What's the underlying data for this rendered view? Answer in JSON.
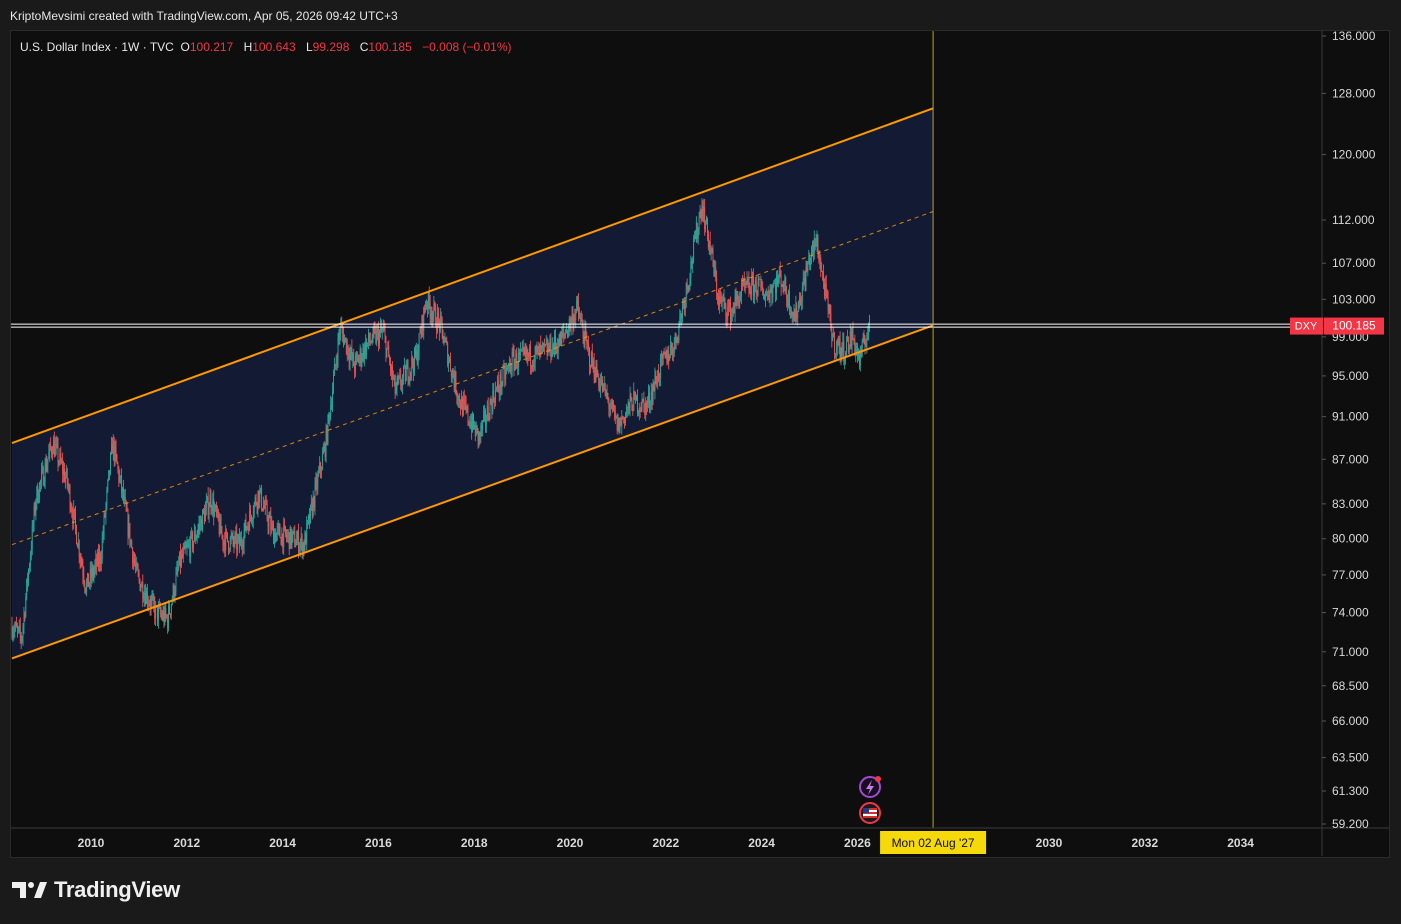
{
  "header": {
    "text": "KriptoMevsimi created with TradingView.com, Apr 05, 2026 09:42 UTC+3"
  },
  "legend": {
    "symbol": "U.S. Dollar Index · 1W · TVC",
    "open_label": "O",
    "open": "100.217",
    "high_label": "H",
    "high": "100.643",
    "low_label": "L",
    "low": "99.298",
    "close_label": "C",
    "close": "100.185",
    "change": "−0.008 (−0.01%)"
  },
  "brand": {
    "name": "TradingView",
    "icon": "tradingview-logo-icon"
  },
  "chart_data": {
    "type": "candlestick",
    "scale": "log",
    "ylim": [
      59.2,
      136.0
    ],
    "xlim": [
      2008.35,
      2035.6
    ],
    "y_ticks": [
      "136.000",
      "128.000",
      "120.000",
      "112.000",
      "107.000",
      "103.000",
      "99.000",
      "95.000",
      "91.000",
      "87.000",
      "83.000",
      "80.000",
      "77.000",
      "74.000",
      "71.000",
      "68.500",
      "66.000",
      "63.500",
      "61.300",
      "59.200"
    ],
    "x_ticks": [
      "2010",
      "2012",
      "2014",
      "2016",
      "2018",
      "2020",
      "2022",
      "2024",
      "2026",
      "2030",
      "2032",
      "2034"
    ],
    "last_price": {
      "symbol": "DXY",
      "value": 100.185,
      "label": "100.185"
    },
    "crosshair": {
      "date_label": "Mon 02 Aug '27",
      "x": 2027.58
    },
    "channel": {
      "start_x": 2008.35,
      "end_x": 2027.58,
      "upper": [
        88.5,
        126.0
      ],
      "middle": [
        79.5,
        113.0
      ],
      "lower": [
        70.5,
        100.2
      ]
    },
    "price_path": [
      [
        2008.35,
        73.0
      ],
      [
        2008.55,
        72.0
      ],
      [
        2008.85,
        83.5
      ],
      [
        2009.2,
        88.5
      ],
      [
        2009.5,
        85.0
      ],
      [
        2009.9,
        76.0
      ],
      [
        2010.2,
        78.5
      ],
      [
        2010.45,
        88.5
      ],
      [
        2010.65,
        84.0
      ],
      [
        2010.95,
        77.0
      ],
      [
        2011.35,
        74.0
      ],
      [
        2011.6,
        73.5
      ],
      [
        2011.85,
        78.0
      ],
      [
        2012.15,
        80.0
      ],
      [
        2012.5,
        83.5
      ],
      [
        2012.75,
        80.0
      ],
      [
        2013.1,
        79.5
      ],
      [
        2013.5,
        84.0
      ],
      [
        2013.8,
        80.5
      ],
      [
        2014.2,
        80.0
      ],
      [
        2014.45,
        79.5
      ],
      [
        2014.9,
        88.5
      ],
      [
        2015.2,
        100.0
      ],
      [
        2015.5,
        96.0
      ],
      [
        2015.8,
        98.5
      ],
      [
        2016.1,
        99.5
      ],
      [
        2016.35,
        93.5
      ],
      [
        2016.8,
        97.0
      ],
      [
        2017.0,
        103.0
      ],
      [
        2017.3,
        100.0
      ],
      [
        2017.7,
        92.5
      ],
      [
        2018.1,
        89.0
      ],
      [
        2018.4,
        93.0
      ],
      [
        2018.8,
        96.5
      ],
      [
        2019.2,
        97.0
      ],
      [
        2019.5,
        97.5
      ],
      [
        2019.8,
        98.5
      ],
      [
        2020.15,
        102.0
      ],
      [
        2020.4,
        97.0
      ],
      [
        2020.75,
        93.0
      ],
      [
        2021.0,
        90.0
      ],
      [
        2021.3,
        92.5
      ],
      [
        2021.6,
        92.0
      ],
      [
        2021.9,
        96.0
      ],
      [
        2022.2,
        98.5
      ],
      [
        2022.5,
        106.0
      ],
      [
        2022.75,
        114.0
      ],
      [
        2022.95,
        108.0
      ],
      [
        2023.1,
        103.0
      ],
      [
        2023.35,
        101.5
      ],
      [
        2023.6,
        104.0
      ],
      [
        2023.9,
        104.5
      ],
      [
        2024.1,
        103.5
      ],
      [
        2024.4,
        105.5
      ],
      [
        2024.7,
        101.0
      ],
      [
        2025.0,
        107.5
      ],
      [
        2025.15,
        109.5
      ],
      [
        2025.35,
        103.0
      ],
      [
        2025.5,
        98.5
      ],
      [
        2025.7,
        97.5
      ],
      [
        2025.9,
        99.0
      ],
      [
        2026.05,
        96.5
      ],
      [
        2026.2,
        99.5
      ],
      [
        2026.26,
        100.2
      ]
    ]
  },
  "colors": {
    "channel_line": "#ff9800",
    "channel_fill": "#131a33",
    "up": "#26a69a",
    "down": "#ef5350",
    "price_line": "#ffffff",
    "price_label_bg": "#f23645",
    "crosshair": "#b8a236",
    "date_label_bg": "#f5d90a"
  },
  "events": [
    {
      "name": "lightning-event-icon"
    },
    {
      "name": "us-flag-event-icon"
    }
  ]
}
